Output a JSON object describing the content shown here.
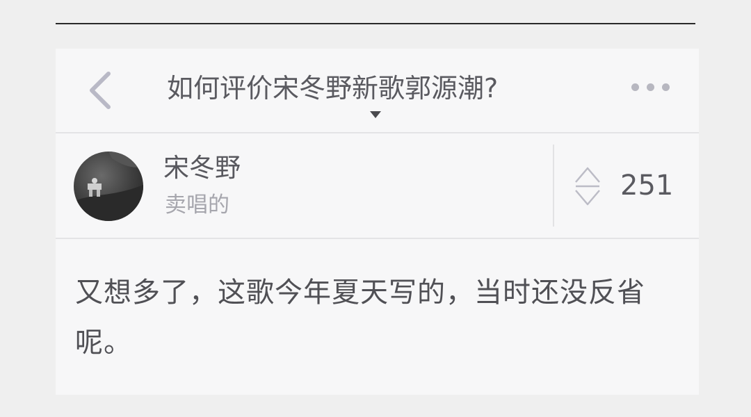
{
  "header": {
    "question_title": "如何评价宋冬野新歌郭源潮?"
  },
  "icons": {
    "back": "chevron-left-icon",
    "more": "more-horizontal-icon",
    "title_expand": "caret-down-icon",
    "vote": "up-down-vote-icon"
  },
  "author": {
    "name": "宋冬野",
    "bio": "卖唱的"
  },
  "vote": {
    "count": "251"
  },
  "answer": {
    "text": "又想多了，这歌今年夏天写的，当时还没反省呢。"
  },
  "colors": {
    "page_bg": "#efefef",
    "card_bg": "#f7f7f8",
    "title_text": "#5a5a60",
    "secondary_text": "#a6a6ad",
    "icon_gray": "#b7b7c0"
  }
}
